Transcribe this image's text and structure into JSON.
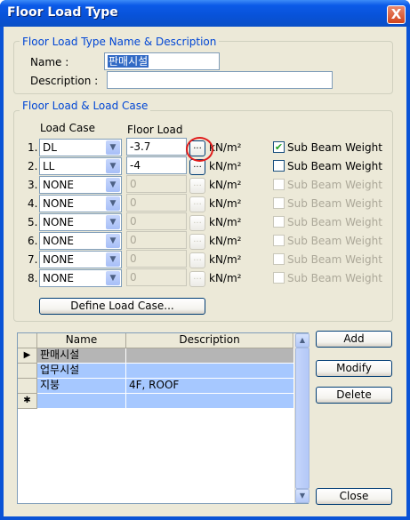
{
  "window": {
    "title": "Floor Load Type",
    "close_symbol": "X"
  },
  "name_group": {
    "legend": "Floor Load Type Name & Description",
    "name_label": "Name :",
    "name_value": "판매시설",
    "description_label": "Description :",
    "description_value": ""
  },
  "load_group": {
    "legend": "Floor Load & Load Case",
    "load_case_header": "Load Case",
    "floor_load_header": "Floor Load",
    "unit": "kN/m²",
    "sub_beam_label": "Sub Beam Weight",
    "dots_label": "...",
    "rows": [
      {
        "index": "1.",
        "load_case": "DL",
        "floor_load": "-3.7",
        "enabled": true,
        "sub_beam_checked": true
      },
      {
        "index": "2.",
        "load_case": "LL",
        "floor_load": "-4",
        "enabled": true,
        "sub_beam_checked": false
      },
      {
        "index": "3.",
        "load_case": "NONE",
        "floor_load": "0",
        "enabled": false,
        "sub_beam_checked": false
      },
      {
        "index": "4.",
        "load_case": "NONE",
        "floor_load": "0",
        "enabled": false,
        "sub_beam_checked": false
      },
      {
        "index": "5.",
        "load_case": "NONE",
        "floor_load": "0",
        "enabled": false,
        "sub_beam_checked": false
      },
      {
        "index": "6.",
        "load_case": "NONE",
        "floor_load": "0",
        "enabled": false,
        "sub_beam_checked": false
      },
      {
        "index": "7.",
        "load_case": "NONE",
        "floor_load": "0",
        "enabled": false,
        "sub_beam_checked": false
      },
      {
        "index": "8.",
        "load_case": "NONE",
        "floor_load": "0",
        "enabled": false,
        "sub_beam_checked": false
      }
    ],
    "define_button": "Define Load Case..."
  },
  "grid": {
    "columns": [
      "Name",
      "Description"
    ],
    "rows": [
      {
        "marker": "▶",
        "name": "판매시설",
        "description": ""
      },
      {
        "marker": "",
        "name": "업무시설",
        "description": ""
      },
      {
        "marker": "",
        "name": "지붕",
        "description": "4F, ROOF"
      },
      {
        "marker": "✱",
        "name": "",
        "description": ""
      }
    ]
  },
  "buttons": {
    "add": "Add",
    "modify": "Modify",
    "delete": "Delete",
    "close": "Close"
  },
  "colors": {
    "title_blue": "#0852d8",
    "legend_blue": "#0046d5",
    "row_blue": "#a6c8ff",
    "highlight_red": "#e01a1a"
  }
}
